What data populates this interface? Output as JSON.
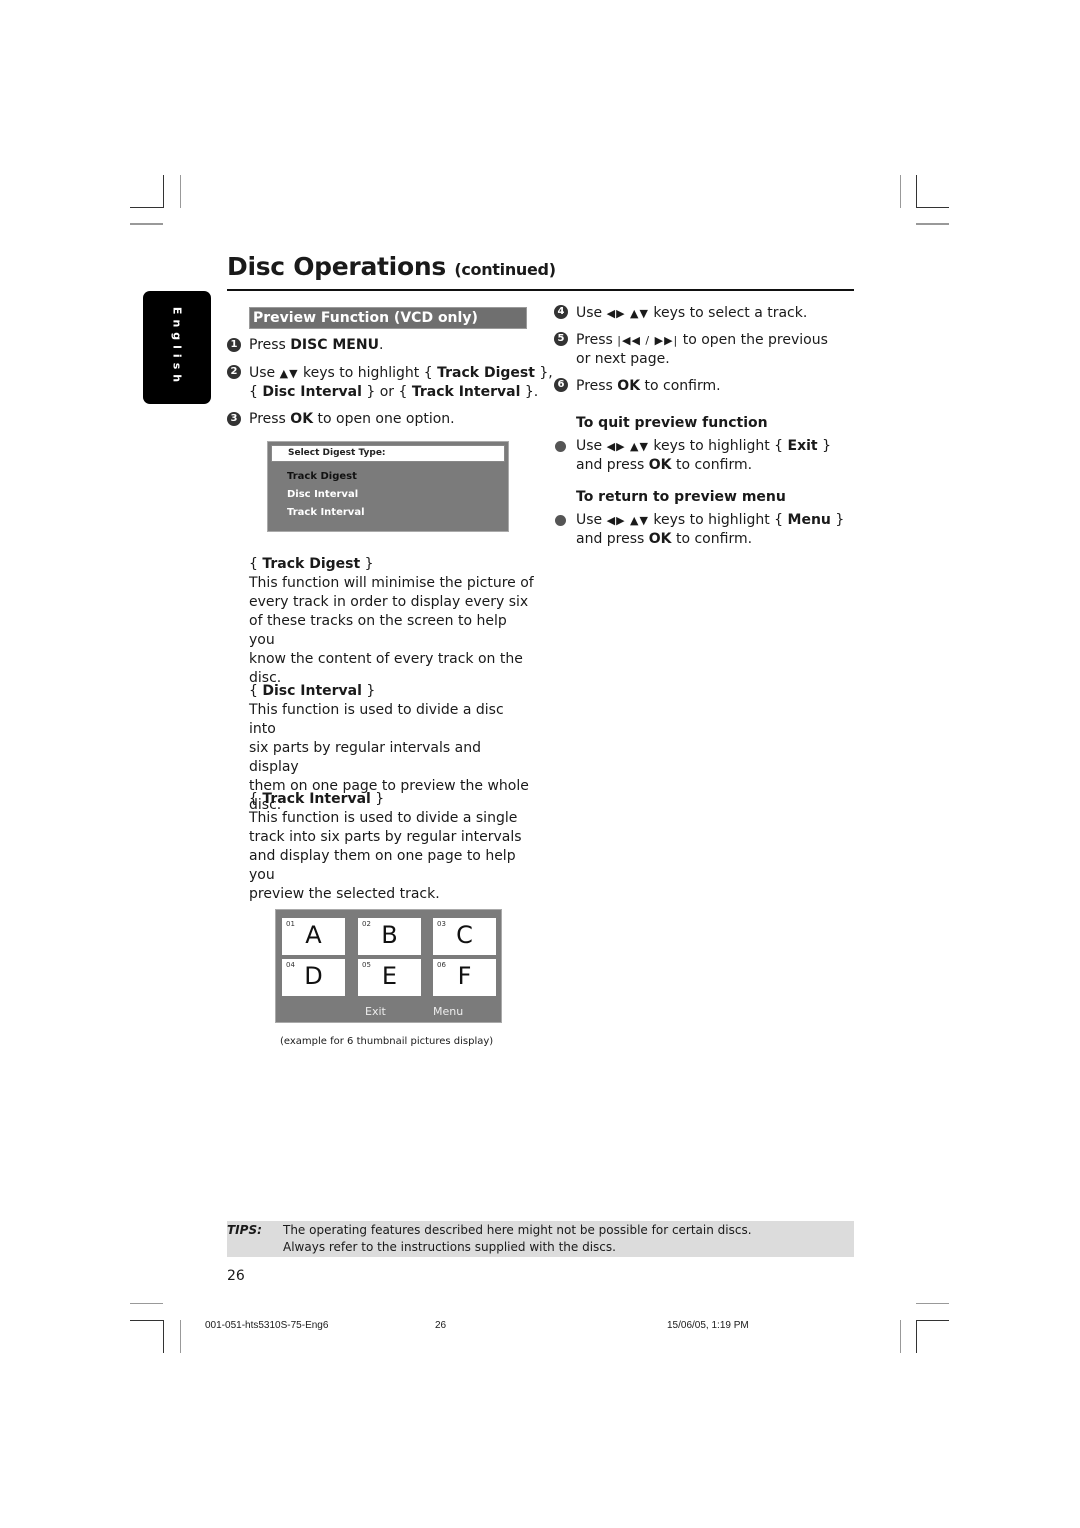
{
  "header": {
    "title": "Disc Operations",
    "title_suffix": "(continued)"
  },
  "language_tab": "English",
  "section": {
    "title": "Preview Function (VCD only)"
  },
  "steps_left": [
    {
      "num": "1",
      "parts": [
        "Press ",
        "DISC MENU",
        "."
      ]
    },
    {
      "num": "2",
      "line1": [
        "Use ",
        "▲▼",
        " keys to highlight { ",
        "Track Digest",
        " },"
      ],
      "line2": [
        "{ ",
        "Disc Interval",
        " } or { ",
        "Track Interval",
        " }."
      ]
    },
    {
      "num": "3",
      "parts": [
        "Press ",
        "OK",
        " to open one option."
      ]
    }
  ],
  "menu_screen": {
    "header": "Select Digest Type:",
    "items": [
      "Track Digest",
      "Disc Interval",
      "Track Interval"
    ],
    "selected": "Track Digest"
  },
  "options": [
    {
      "name": "Track Digest",
      "lines": [
        "This function will minimise the picture of",
        "every track in order to display every six",
        "of these tracks on the screen to help you",
        "know the content of every track on the",
        "disc."
      ]
    },
    {
      "name": "Disc Interval",
      "lines": [
        "This function is used to divide a disc into",
        "six parts by regular intervals and display",
        "them on one page to preview the whole",
        "disc."
      ]
    },
    {
      "name": "Track Interval",
      "lines": [
        "This function is used to divide a single",
        "track into six parts by regular intervals",
        "and display them on one page to help you",
        "preview the selected track."
      ]
    }
  ],
  "thumbnail_screen": {
    "thumbs": [
      {
        "num": "01",
        "letter": "A"
      },
      {
        "num": "02",
        "letter": "B"
      },
      {
        "num": "03",
        "letter": "C"
      },
      {
        "num": "04",
        "letter": "D"
      },
      {
        "num": "05",
        "letter": "E"
      },
      {
        "num": "06",
        "letter": "F"
      }
    ],
    "buttons": [
      "Exit",
      "Menu"
    ],
    "caption": "(example for 6 thumbnail pictures display)"
  },
  "steps_right": [
    {
      "num": "4",
      "parts": [
        "Use ",
        "◀▶ ▲▼",
        " keys to select a track."
      ]
    },
    {
      "num": "5",
      "line1": [
        "Press ",
        "|◀◀ / ▶▶|",
        " to open the previous"
      ],
      "line2": "or next page."
    },
    {
      "num": "6",
      "parts": [
        "Press ",
        "OK",
        " to confirm."
      ]
    }
  ],
  "quit": {
    "heading": "To quit preview function",
    "line1": [
      "Use ",
      "◀▶ ▲▼",
      " keys to highlight { ",
      "Exit",
      " }"
    ],
    "line2": [
      "and press ",
      "OK",
      " to confirm."
    ]
  },
  "return": {
    "heading": "To return to preview menu",
    "line1": [
      "Use ",
      "◀▶ ▲▼",
      " keys to highlight { ",
      "Menu",
      " }"
    ],
    "line2": [
      "and press ",
      "OK",
      " to confirm."
    ]
  },
  "tips": {
    "label": "TIPS:",
    "line1": "The operating features described here might not be possible for certain discs.",
    "line2": "Always refer to the instructions supplied with the discs."
  },
  "page_number": "26",
  "footer": {
    "file": "001-051-hts5310S-75-Eng6",
    "page": "26",
    "date": "15/06/05, 1:19 PM"
  }
}
